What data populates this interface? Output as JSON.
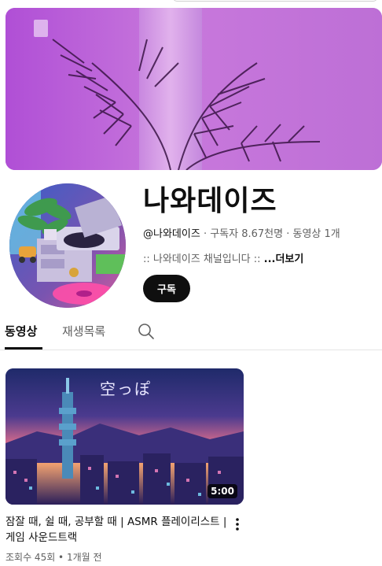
{
  "channel": {
    "name": "나와데이즈",
    "handle": "@나와데이즈",
    "meta_rest": " · 구독자 8.67천명 · 동영상 1개",
    "description": ":: 나와데이즈 채널입니다 :: ",
    "more_label": "...더보기",
    "subscribe_label": "구독"
  },
  "tabs": [
    {
      "label": "동영상",
      "active": true
    },
    {
      "label": "재생목록",
      "active": false
    }
  ],
  "videos": [
    {
      "thumbnail_text": "空っぽ",
      "duration": "5:00",
      "title": "잠잘 때, 쉴 때, 공부할 때 | ASMR 플레이리스트 | 게임 사운드트랙",
      "stats": "조회수 45회 • 1개월 전"
    }
  ],
  "colors": {
    "banner_purple": "#b95fd8",
    "subscribe_bg": "#0f0f0f",
    "text_secondary": "#606060"
  },
  "icons": {
    "search": "search-icon",
    "more": "more-vert-icon"
  }
}
